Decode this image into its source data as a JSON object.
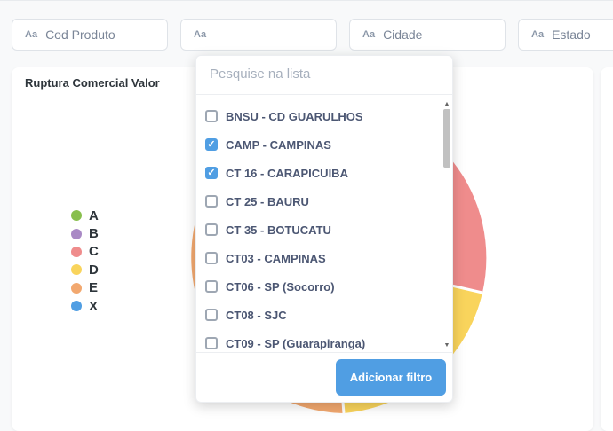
{
  "filters": [
    {
      "aa": "Aa",
      "label": "Cod Produto"
    },
    {
      "aa": "Aa",
      "label": ""
    },
    {
      "aa": "Aa",
      "label": "Cidade"
    },
    {
      "aa": "Aa",
      "label": "Estado"
    }
  ],
  "card": {
    "title": "Ruptura Comercial Valor",
    "legend": [
      {
        "label": "A",
        "color": "#88bf4d"
      },
      {
        "label": "B",
        "color": "#a989c5"
      },
      {
        "label": "C",
        "color": "#ef8c8c"
      },
      {
        "label": "D",
        "color": "#f9d45c"
      },
      {
        "label": "E",
        "color": "#f2a86f"
      },
      {
        "label": "X",
        "color": "#509ee3"
      }
    ]
  },
  "popover": {
    "search_placeholder": "Pesquise na lista",
    "options": [
      {
        "label": "BNSU - CD GUARULHOS",
        "checked": false
      },
      {
        "label": "CAMP - CAMPINAS",
        "checked": true
      },
      {
        "label": "CT 16 - CARAPICUIBA",
        "checked": true
      },
      {
        "label": "CT 25 - BAURU",
        "checked": false
      },
      {
        "label": "CT 35 - BOTUCATU",
        "checked": false
      },
      {
        "label": "CT03 - CAMPINAS",
        "checked": false
      },
      {
        "label": "CT06 - SP (Socorro)",
        "checked": false
      },
      {
        "label": "CT08 - SJC",
        "checked": false
      },
      {
        "label": "CT09 - SP (Guarapiranga)",
        "checked": false
      }
    ],
    "add_button": "Adicionar filtro",
    "checkmark": "✓"
  }
}
